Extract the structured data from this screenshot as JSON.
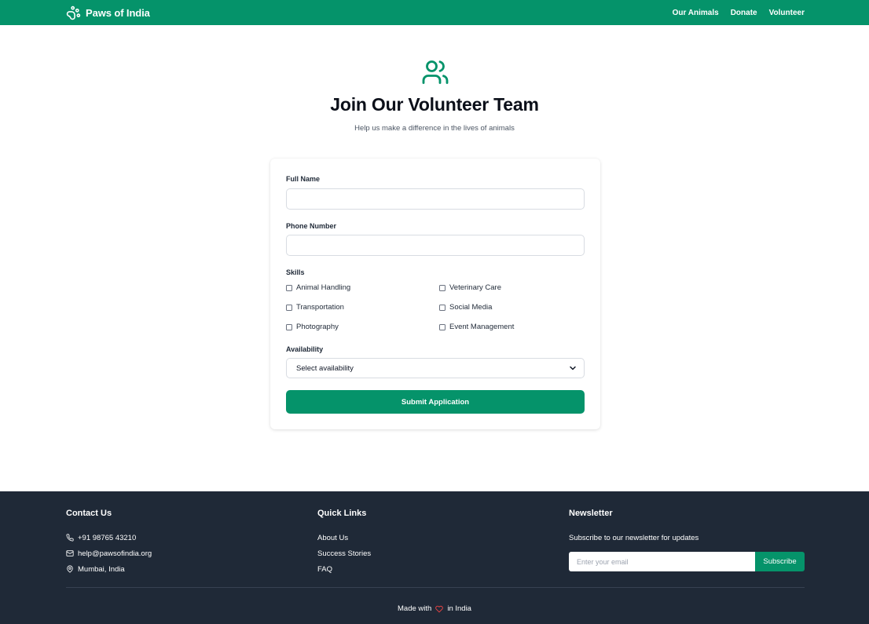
{
  "nav": {
    "brand": "Paws of India",
    "brand_icon": "paw-print-icon",
    "links": [
      "Our Animals",
      "Donate",
      "Volunteer"
    ]
  },
  "hero": {
    "icon": "users-icon",
    "title": "Join Our Volunteer Team",
    "subtitle": "Help us make a difference in the lives of animals"
  },
  "form": {
    "full_name_label": "Full Name",
    "full_name_value": "",
    "phone_label": "Phone Number",
    "phone_value": "",
    "skills_label": "Skills",
    "skills": [
      "Animal Handling",
      "Veterinary Care",
      "Transportation",
      "Social Media",
      "Photography",
      "Event Management"
    ],
    "availability_label": "Availability",
    "availability_selected": "Select availability",
    "submit_label": "Submit Application"
  },
  "footer": {
    "contact": {
      "heading": "Contact Us",
      "phone": "+91 98765 43210",
      "email": "help@pawsofindia.org",
      "location": "Mumbai, India"
    },
    "quick_links": {
      "heading": "Quick Links",
      "links": [
        "About Us",
        "Success Stories",
        "FAQ"
      ]
    },
    "newsletter": {
      "heading": "Newsletter",
      "text": "Subscribe to our newsletter for updates",
      "placeholder": "Enter your email",
      "button": "Subscribe"
    },
    "made_prefix": "Made with",
    "made_suffix": "in India"
  },
  "colors": {
    "brand_green": "#05936a",
    "footer_bg": "#1f2937",
    "heart_red": "#ef4444"
  }
}
